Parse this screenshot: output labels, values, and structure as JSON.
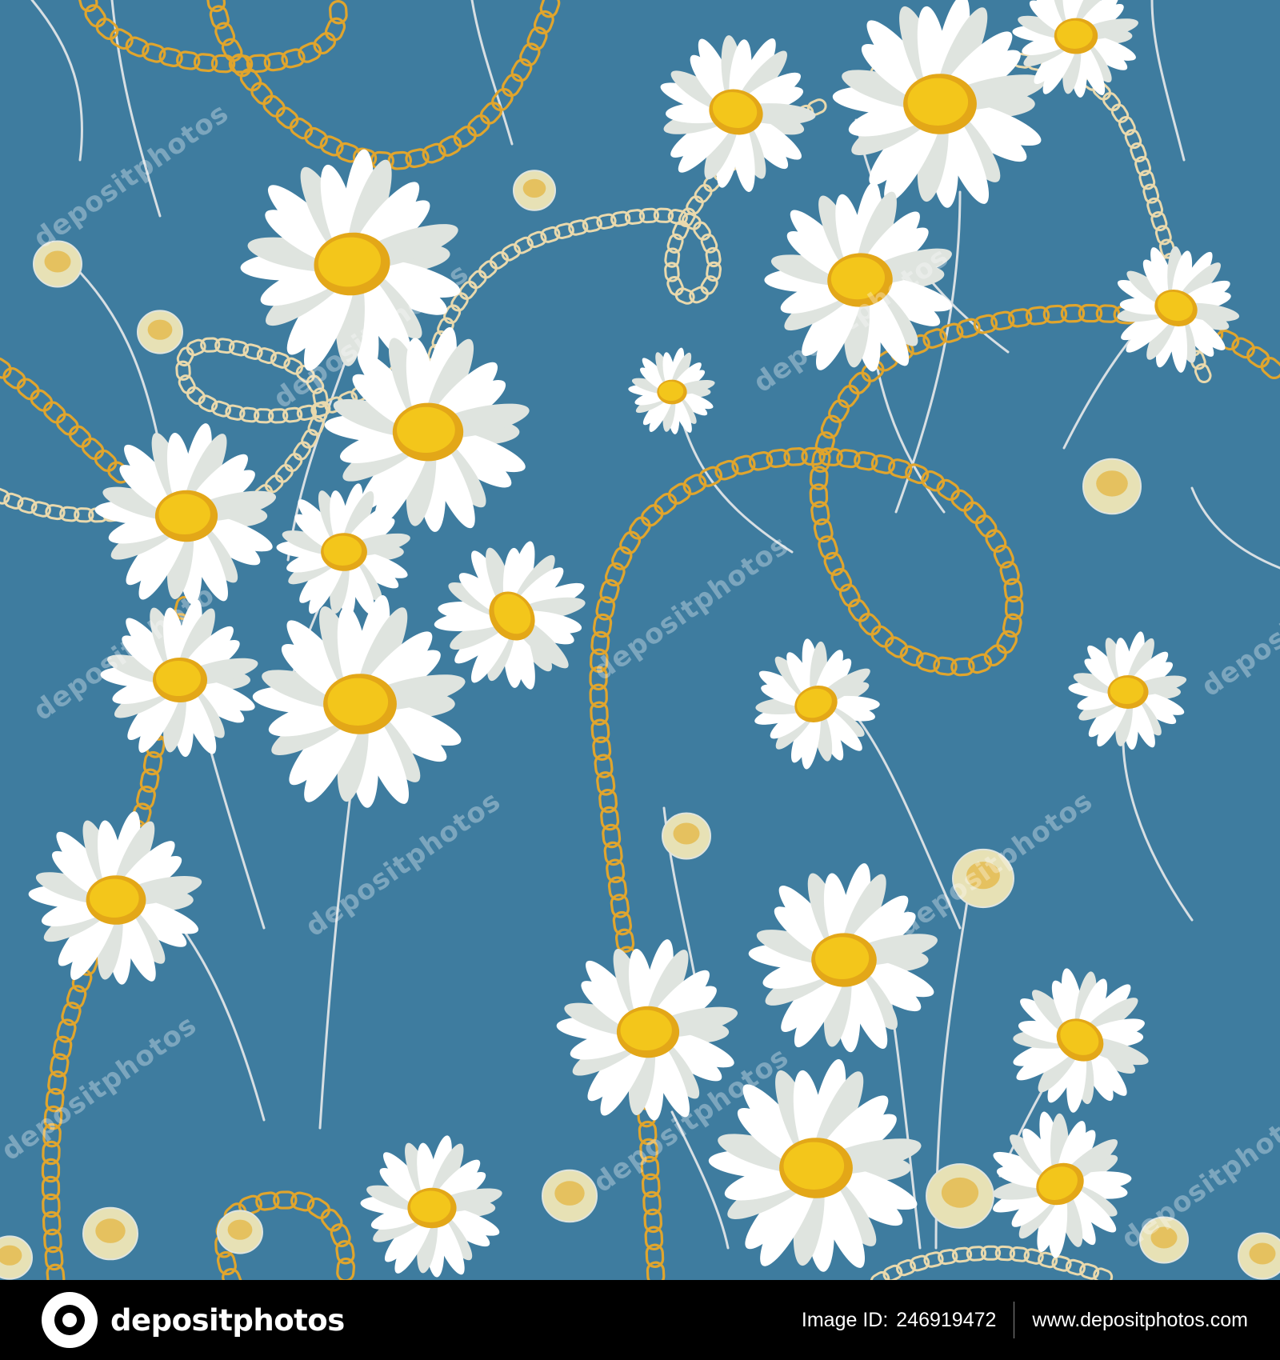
{
  "watermark": {
    "text": "depositphotos"
  },
  "footer": {
    "brand": "depositphotos",
    "image_id_label": "Image ID:",
    "image_id": "246919472",
    "site": "www.depositphotos.com"
  },
  "palette": {
    "background": "#3e7c9f",
    "petal": "#ffffff",
    "petal_shade": "#dfe4df",
    "center": "#f3c61b",
    "center_dark": "#e3a718",
    "chain_gold": "#e0a52d",
    "chain_pale": "#e9d9ad",
    "bud": "#e7e1b5",
    "stem": "#d8dfe3",
    "footer_bg": "#000000"
  },
  "icons": {
    "logo": "depositphotos-logo-icon"
  }
}
